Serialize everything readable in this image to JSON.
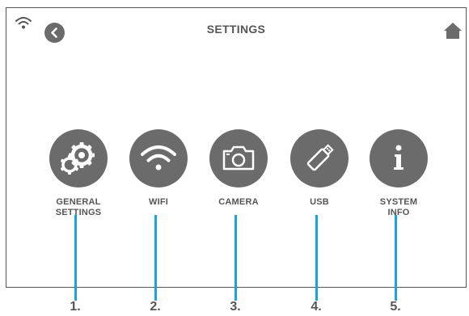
{
  "header": {
    "title": "SETTINGS",
    "wifi_status_icon": "wifi-signal-icon",
    "back_icon": "chevron-left-icon",
    "home_icon": "home-icon"
  },
  "menu": [
    {
      "label_line1": "GENERAL",
      "label_line2": "SETTINGS",
      "icon": "gears-icon",
      "number": "1."
    },
    {
      "label_line1": "WIFI",
      "label_line2": "",
      "icon": "wifi-icon",
      "number": "2."
    },
    {
      "label_line1": "CAMERA",
      "label_line2": "",
      "icon": "camera-icon",
      "number": "3."
    },
    {
      "label_line1": "USB",
      "label_line2": "",
      "icon": "usb-drive-icon",
      "number": "4."
    },
    {
      "label_line1": "SYSTEM",
      "label_line2": "INFO",
      "icon": "info-icon",
      "number": "5."
    }
  ],
  "colors": {
    "icon_circle": "#6b6b6b",
    "text": "#555555",
    "callout_line": "#1ba3dc"
  }
}
